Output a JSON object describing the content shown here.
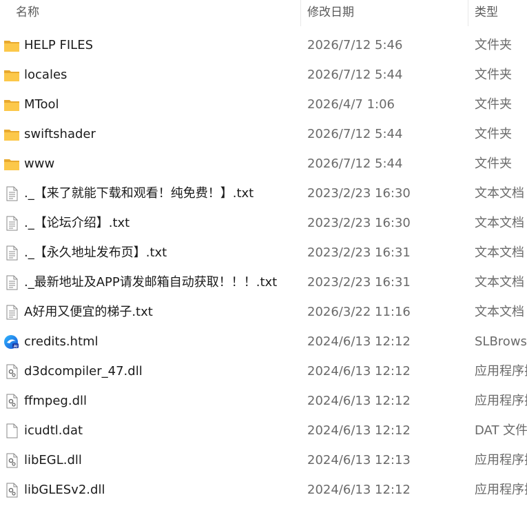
{
  "columns": {
    "name": "名称",
    "date": "修改日期",
    "type": "类型"
  },
  "files": [
    {
      "icon": "folder-icon",
      "name": "HELP FILES",
      "date": "2026/7/12 5:46",
      "type": "文件夹"
    },
    {
      "icon": "folder-icon",
      "name": "locales",
      "date": "2026/7/12 5:44",
      "type": "文件夹"
    },
    {
      "icon": "folder-icon",
      "name": "MTool",
      "date": "2026/4/7 1:06",
      "type": "文件夹"
    },
    {
      "icon": "folder-icon",
      "name": "swiftshader",
      "date": "2026/7/12 5:44",
      "type": "文件夹"
    },
    {
      "icon": "folder-icon",
      "name": "www",
      "date": "2026/7/12 5:44",
      "type": "文件夹"
    },
    {
      "icon": "text-file-icon",
      "name": "._【来了就能下载和观看！纯免费！】.txt",
      "date": "2023/2/23 16:30",
      "type": "文本文档"
    },
    {
      "icon": "text-file-icon",
      "name": "._【论坛介绍】.txt",
      "date": "2023/2/23 16:30",
      "type": "文本文档"
    },
    {
      "icon": "text-file-icon",
      "name": "._【永久地址发布页】.txt",
      "date": "2023/2/23 16:31",
      "type": "文本文档"
    },
    {
      "icon": "text-file-icon",
      "name": "._最新地址及APP请发邮箱自动获取！！！.txt",
      "date": "2023/2/23 16:31",
      "type": "文本文档"
    },
    {
      "icon": "text-file-icon",
      "name": "A好用又便宜的梯子.txt",
      "date": "2026/3/22 11:16",
      "type": "文本文档"
    },
    {
      "icon": "browser-html-icon",
      "name": "credits.html",
      "date": "2024/6/13 12:12",
      "type": "SLBrowser"
    },
    {
      "icon": "dll-file-icon",
      "name": "d3dcompiler_47.dll",
      "date": "2024/6/13 12:12",
      "type": "应用程序扩展"
    },
    {
      "icon": "dll-file-icon",
      "name": "ffmpeg.dll",
      "date": "2024/6/13 12:12",
      "type": "应用程序扩展"
    },
    {
      "icon": "blank-file-icon",
      "name": "icudtl.dat",
      "date": "2024/6/13 12:12",
      "type": "DAT 文件"
    },
    {
      "icon": "dll-file-icon",
      "name": "libEGL.dll",
      "date": "2024/6/13 12:13",
      "type": "应用程序扩展"
    },
    {
      "icon": "dll-file-icon",
      "name": "libGLESv2.dll",
      "date": "2024/6/13 12:12",
      "type": "应用程序扩展"
    }
  ]
}
